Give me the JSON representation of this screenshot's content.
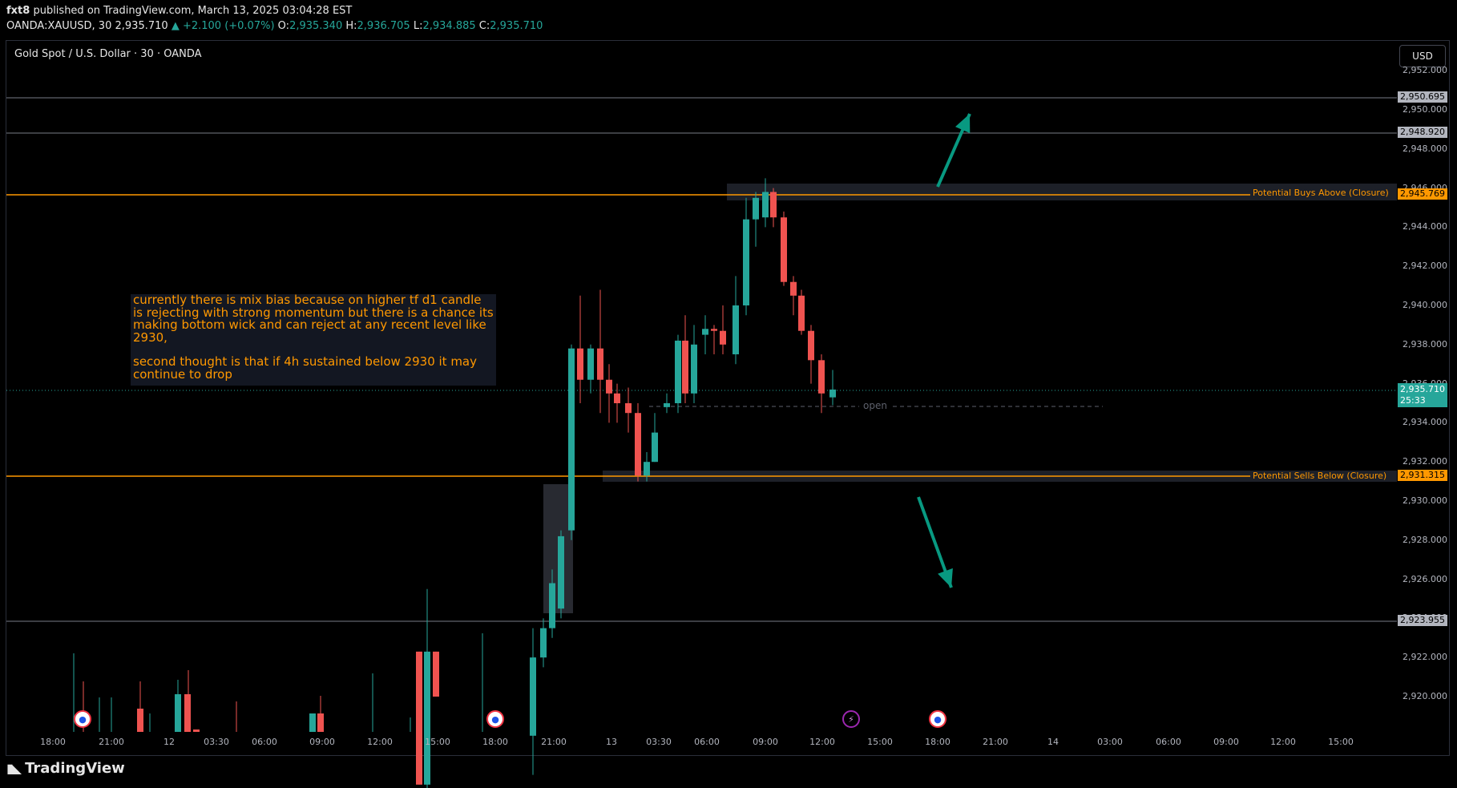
{
  "header": {
    "author": "fxt8",
    "published": "published on TradingView.com, March 13, 2025 03:04:28 EST",
    "symbol": "OANDA:XAUUSD, 30",
    "last": "2,935.710",
    "change": "+2.100 (+0.07%)",
    "o_label": "O:",
    "o_val": "2,935.340",
    "h_label": "H:",
    "h_val": "2,936.705",
    "l_label": "L:",
    "l_val": "2,934.885",
    "c_label": "C:",
    "c_val": "2,935.710"
  },
  "chart": {
    "legend": "Gold Spot / U.S. Dollar · 30 · OANDA",
    "currency": "USD",
    "note_line1": "currently there is mix bias because on higher tf d1 candle is rejecting with strong momentum but there is a chance its making bottom wick and can reject at any recent level like 2930,",
    "note_line2": "second thought is that if 4h sustained below 2930 it may continue to drop",
    "buys_label": "Potential Buys Above (Closure)",
    "sells_label": "Potential Sells Below (Closure)",
    "open_label": "open",
    "price_tags": {
      "p1": "2,950.695",
      "p2": "2,948.920",
      "buys": "2,945.769",
      "current": "2,935.710",
      "countdown": "25:33",
      "sells": "2,931.315",
      "p3": "2,923.955"
    },
    "y_axis": [
      "2,952.000",
      "2,950.000",
      "2,948.000",
      "2,946.000",
      "2,944.000",
      "2,942.000",
      "2,940.000",
      "2,938.000",
      "2,936.000",
      "2,934.000",
      "2,932.000",
      "2,930.000",
      "2,928.000",
      "2,926.000",
      "2,924.000",
      "2,922.000",
      "2,920.000"
    ],
    "x_axis": [
      "18:00",
      "21:00",
      "12",
      "03:30",
      "06:00",
      "09:00",
      "12:00",
      "15:00",
      "18:00",
      "21:00",
      "13",
      "03:30",
      "06:00",
      "09:00",
      "12:00",
      "15:00",
      "18:00",
      "21:00",
      "14",
      "03:00",
      "06:00",
      "09:00",
      "12:00",
      "15:00"
    ],
    "colors": {
      "up": "#26a69a",
      "down": "#ef5350",
      "level": "#ff9800",
      "arrow": "#089981"
    }
  },
  "chart_data": {
    "type": "candlestick",
    "title": "Gold Spot / U.S. Dollar · 30 · OANDA",
    "ylim": [
      2919,
      2952.5
    ],
    "candles": [
      {
        "x": "12 13:30",
        "o": 2922.3,
        "h": 2922.3,
        "l": 2915.5,
        "c": 2915.5
      },
      {
        "x": "12 14:00",
        "o": 2915.5,
        "h": 2925.5,
        "l": 2915.0,
        "c": 2922.3
      },
      {
        "x": "12 14:30",
        "o": 2922.3,
        "h": 2922.3,
        "l": 2920.0,
        "c": 2920.0
      },
      {
        "x": "12 20:00",
        "o": 2918.0,
        "h": 2923.5,
        "l": 2916.0,
        "c": 2922.0
      },
      {
        "x": "12 20:30",
        "o": 2922.0,
        "h": 2924.0,
        "l": 2921.5,
        "c": 2923.5
      },
      {
        "x": "12 21:00",
        "o": 2923.5,
        "h": 2926.5,
        "l": 2923.0,
        "c": 2925.8
      },
      {
        "x": "12 21:30",
        "o": 2924.5,
        "h": 2928.5,
        "l": 2924.0,
        "c": 2928.2
      },
      {
        "x": "12 22:00",
        "o": 2928.5,
        "h": 2938.0,
        "l": 2928.0,
        "c": 2937.8
      },
      {
        "x": "12 22:30",
        "o": 2937.8,
        "h": 2940.5,
        "l": 2935.0,
        "c": 2936.2
      },
      {
        "x": "12 23:00",
        "o": 2936.2,
        "h": 2938.0,
        "l": 2935.5,
        "c": 2937.8
      },
      {
        "x": "13 00:00",
        "o": 2937.8,
        "h": 2940.8,
        "l": 2934.5,
        "c": 2936.2
      },
      {
        "x": "13 00:30",
        "o": 2936.2,
        "h": 2937.0,
        "l": 2934.0,
        "c": 2935.5
      },
      {
        "x": "13 01:00",
        "o": 2935.5,
        "h": 2936.0,
        "l": 2934.0,
        "c": 2935.0
      },
      {
        "x": "13 01:30",
        "o": 2935.0,
        "h": 2935.8,
        "l": 2933.5,
        "c": 2934.5
      },
      {
        "x": "13 02:00",
        "o": 2934.5,
        "h": 2935.0,
        "l": 2931.0,
        "c": 2931.3
      },
      {
        "x": "13 02:30",
        "o": 2931.3,
        "h": 2932.5,
        "l": 2931.0,
        "c": 2932.0
      },
      {
        "x": "13 03:00",
        "o": 2932.0,
        "h": 2934.5,
        "l": 2932.0,
        "c": 2933.5
      },
      {
        "x": "13 04:00",
        "o": 2934.8,
        "h": 2935.5,
        "l": 2934.5,
        "c": 2935.0
      },
      {
        "x": "13 04:30",
        "o": 2935.0,
        "h": 2938.5,
        "l": 2934.5,
        "c": 2938.2
      },
      {
        "x": "13 05:00",
        "o": 2938.2,
        "h": 2939.5,
        "l": 2935.0,
        "c": 2935.5
      },
      {
        "x": "13 05:30",
        "o": 2935.5,
        "h": 2939.0,
        "l": 2935.0,
        "c": 2938.0
      },
      {
        "x": "13 06:00",
        "o": 2938.5,
        "h": 2939.5,
        "l": 2937.5,
        "c": 2938.8
      },
      {
        "x": "13 06:30",
        "o": 2938.8,
        "h": 2939.0,
        "l": 2937.5,
        "c": 2938.7
      },
      {
        "x": "13 07:00",
        "o": 2938.7,
        "h": 2940.0,
        "l": 2937.5,
        "c": 2938.0
      },
      {
        "x": "13 08:00",
        "o": 2937.5,
        "h": 2941.5,
        "l": 2937.0,
        "c": 2940.0
      },
      {
        "x": "13 08:30",
        "o": 2940.0,
        "h": 2945.5,
        "l": 2939.5,
        "c": 2944.4
      },
      {
        "x": "13 09:00",
        "o": 2944.4,
        "h": 2945.8,
        "l": 2943.0,
        "c": 2945.5
      },
      {
        "x": "13 09:30",
        "o": 2944.5,
        "h": 2946.5,
        "l": 2944.0,
        "c": 2945.8
      },
      {
        "x": "13 10:00",
        "o": 2945.8,
        "h": 2946.0,
        "l": 2944.0,
        "c": 2944.5
      },
      {
        "x": "13 10:30",
        "o": 2944.5,
        "h": 2944.8,
        "l": 2941.0,
        "c": 2941.2
      },
      {
        "x": "13 11:00",
        "o": 2941.2,
        "h": 2941.5,
        "l": 2939.5,
        "c": 2940.5
      },
      {
        "x": "13 11:30",
        "o": 2940.5,
        "h": 2940.8,
        "l": 2938.5,
        "c": 2938.7
      },
      {
        "x": "13 12:00",
        "o": 2938.7,
        "h": 2939.0,
        "l": 2936.0,
        "c": 2937.2
      },
      {
        "x": "13 12:30",
        "o": 2937.2,
        "h": 2937.5,
        "l": 2934.5,
        "c": 2935.5
      },
      {
        "x": "13 13:00",
        "o": 2935.3,
        "h": 2936.7,
        "l": 2934.9,
        "c": 2935.7
      }
    ],
    "levels": [
      {
        "label": "Potential Buys Above (Closure)",
        "value": 2945.769
      },
      {
        "label": "Potential Sells Below (Closure)",
        "value": 2931.315
      }
    ]
  }
}
